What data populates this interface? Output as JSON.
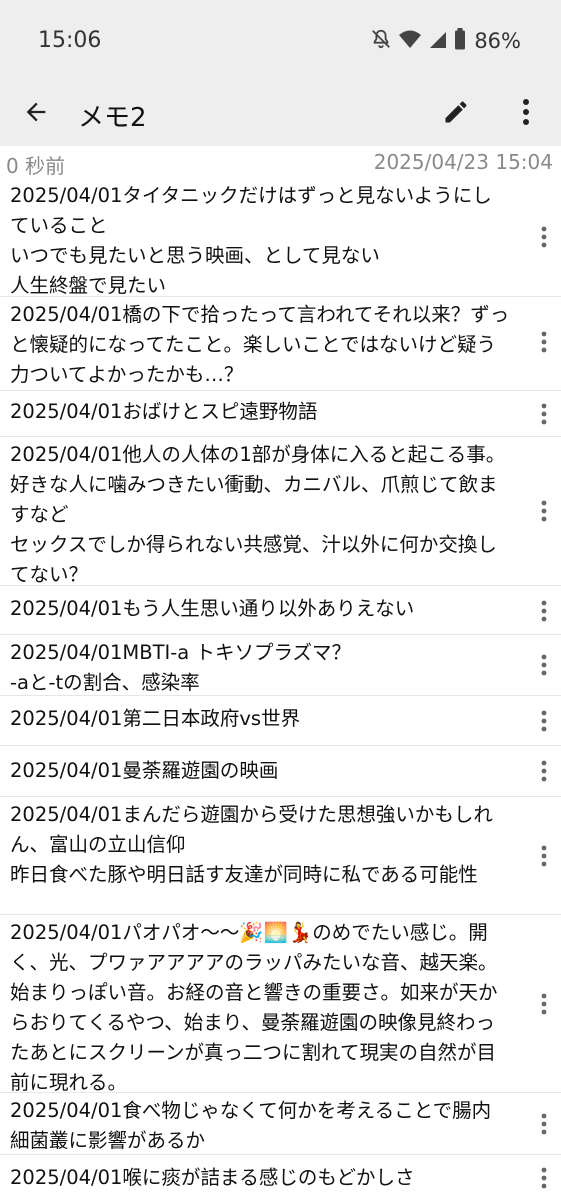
{
  "status": {
    "time": "15:06",
    "battery": "86%",
    "icons": [
      "mute-icon",
      "wifi-icon",
      "signal-icon",
      "battery-icon"
    ]
  },
  "appbar": {
    "title": "メモ2",
    "back_icon": "arrow-back-icon",
    "edit_icon": "pencil-icon",
    "more_icon": "more-vert-icon"
  },
  "meta": {
    "elapsed": "0 秒前",
    "datetime": "2025/04/23 15:04"
  },
  "memos": [
    "2025/04/01タイタニックだけはずっと見ないようにしていること\nいつでも見たいと思う映画、として見ない\n人生終盤で見たい",
    "2025/04/01橋の下で拾ったって言われてそれ以来？ずっと懐疑的になってたこと。楽しいことではないけど疑う力ついてよかったかも…？",
    "2025/04/01おばけとスピ遠野物語",
    "2025/04/01他人の人体の1部が身体に入ると起こる事。好きな人に噛みつきたい衝動、カニバル、爪煎じて飲ますなど\nセックスでしか得られない共感覚、汁以外に何か交換してない？",
    "2025/04/01もう人生思い通り以外ありえない",
    "2025/04/01MBTI-a トキソプラズマ？\n-aと-tの割合、感染率",
    "2025/04/01第二日本政府vs世界",
    "2025/04/01曼荼羅遊園の映画",
    "2025/04/01まんだら遊園から受けた思想強いかもしれん、富山の立山信仰\n昨日食べた豚や明日話す友達が同時に私である可能性",
    "2025/04/01パオパオ〜〜🎉🌅💃のめでたい感じ。開く、光、プワァアアアアのラッパみたいな音、越天楽。始まりっぽい音。お経の音と響きの重要さ。如来が天からおりてくるやつ、始まり、曼荼羅遊園の映像見終わったあとにスクリーンが真っ二つに割れて現実の自然が目前に現れる。",
    "2025/04/01食べ物じゃなくて何かを考えることで腸内細菌叢に影響があるか",
    "2025/04/01喉に痰が詰まる感じのもどかしさ"
  ]
}
